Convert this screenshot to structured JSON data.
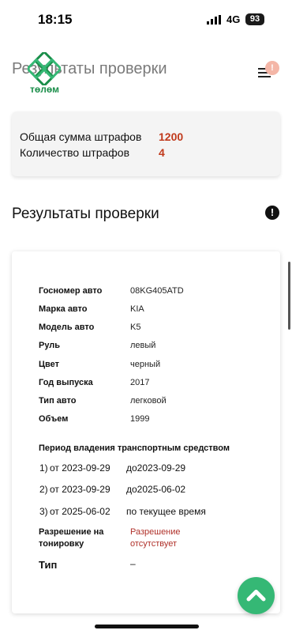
{
  "status_bar": {
    "time": "18:15",
    "network": "4G",
    "battery": "93"
  },
  "header": {
    "title": "Результаты проверки",
    "logo_text": "төлөм",
    "notification_count": "!"
  },
  "summary": {
    "total_label": "Общая сумма штрафов",
    "total_value": "1200",
    "count_label": "Количество штрафов",
    "count_value": "4"
  },
  "section": {
    "title": "Результаты проверки",
    "info_symbol": "!"
  },
  "vehicle": {
    "rows": [
      {
        "label": "Госномер авто",
        "value": "08KG405ATD"
      },
      {
        "label": "Марка авто",
        "value": "KIA"
      },
      {
        "label": "Модель авто",
        "value": "K5"
      },
      {
        "label": "Руль",
        "value": "левый"
      },
      {
        "label": "Цвет",
        "value": "черный"
      },
      {
        "label": "Год выпуска",
        "value": "2017"
      },
      {
        "label": "Тип авто",
        "value": "легковой"
      },
      {
        "label": "Объем",
        "value": "1999"
      }
    ],
    "period_title": "Период владения транспортным средством",
    "periods": [
      {
        "num": "1)",
        "from": "от 2023-09-29",
        "to": "до2023-09-29"
      },
      {
        "num": "2)",
        "from": "от 2023-09-29",
        "to": "до2025-06-02"
      },
      {
        "num": "3)",
        "from": "от 2025-06-02",
        "to": "по текущее время"
      }
    ],
    "tint_label": "Разрешение на тонировку",
    "tint_value": "Разрешение отсутствует",
    "type_label": "Тип",
    "type_value": "–"
  },
  "colors": {
    "brand": "#35b875",
    "accent_red": "#c0391b"
  },
  "icons": [
    "signal-icon",
    "menu-icon",
    "info-icon",
    "chevron-up-icon",
    "logo-icon"
  ]
}
